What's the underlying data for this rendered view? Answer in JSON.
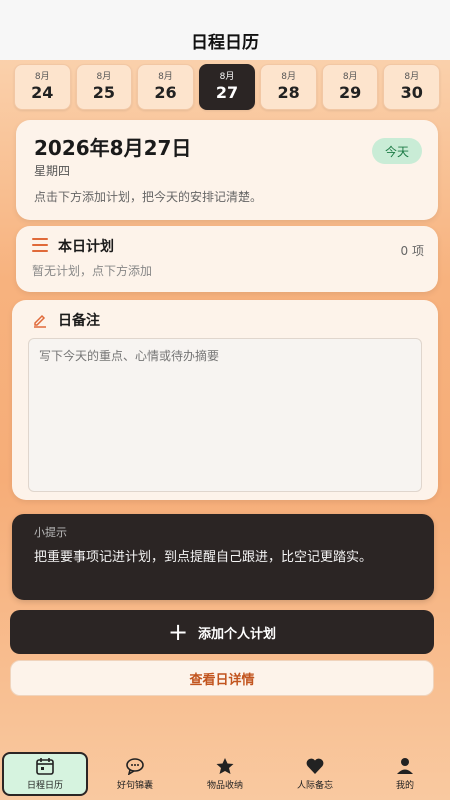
{
  "header": {
    "title": "日程日历"
  },
  "dates": [
    {
      "month": "8月",
      "day": "24",
      "active": false
    },
    {
      "month": "8月",
      "day": "25",
      "active": false
    },
    {
      "month": "8月",
      "day": "26",
      "active": false
    },
    {
      "month": "8月",
      "day": "27",
      "active": true
    },
    {
      "month": "8月",
      "day": "28",
      "active": false
    },
    {
      "month": "8月",
      "day": "29",
      "active": false
    },
    {
      "month": "8月",
      "day": "30",
      "active": false
    }
  ],
  "today_card": {
    "date": "2026年8月27日",
    "weekday": "星期四",
    "hint": "点击下方添加计划，把今天的安排记清楚。",
    "badge": "今天"
  },
  "plan_card": {
    "title": "本日计划",
    "count": "0 项",
    "empty": "暂无计划，点下方添加",
    "icon": "list-icon"
  },
  "note_card": {
    "title": "日备注",
    "placeholder": "写下今天的重点、心情或待办摘要",
    "value": "",
    "icon": "edit-icon"
  },
  "tip": {
    "title": "小提示",
    "text": "把重要事项记进计划，到点提醒自己跟进，比空记更踏实。"
  },
  "buttons": {
    "add": "添加个人计划",
    "view": "查看日详情"
  },
  "tabs": [
    {
      "label": "日程日历",
      "icon": "calendar-icon",
      "active": true
    },
    {
      "label": "好句锦囊",
      "icon": "chat-icon",
      "active": false
    },
    {
      "label": "物品收纳",
      "icon": "star-icon",
      "active": false
    },
    {
      "label": "人际备忘",
      "icon": "heart-icon",
      "active": false
    },
    {
      "label": "我的",
      "icon": "user-icon",
      "active": false
    }
  ],
  "colors": {
    "accent": "#e06a3a",
    "dark": "#2b2524",
    "badge_bg": "#c9ecd6",
    "badge_text": "#1c7a45"
  }
}
